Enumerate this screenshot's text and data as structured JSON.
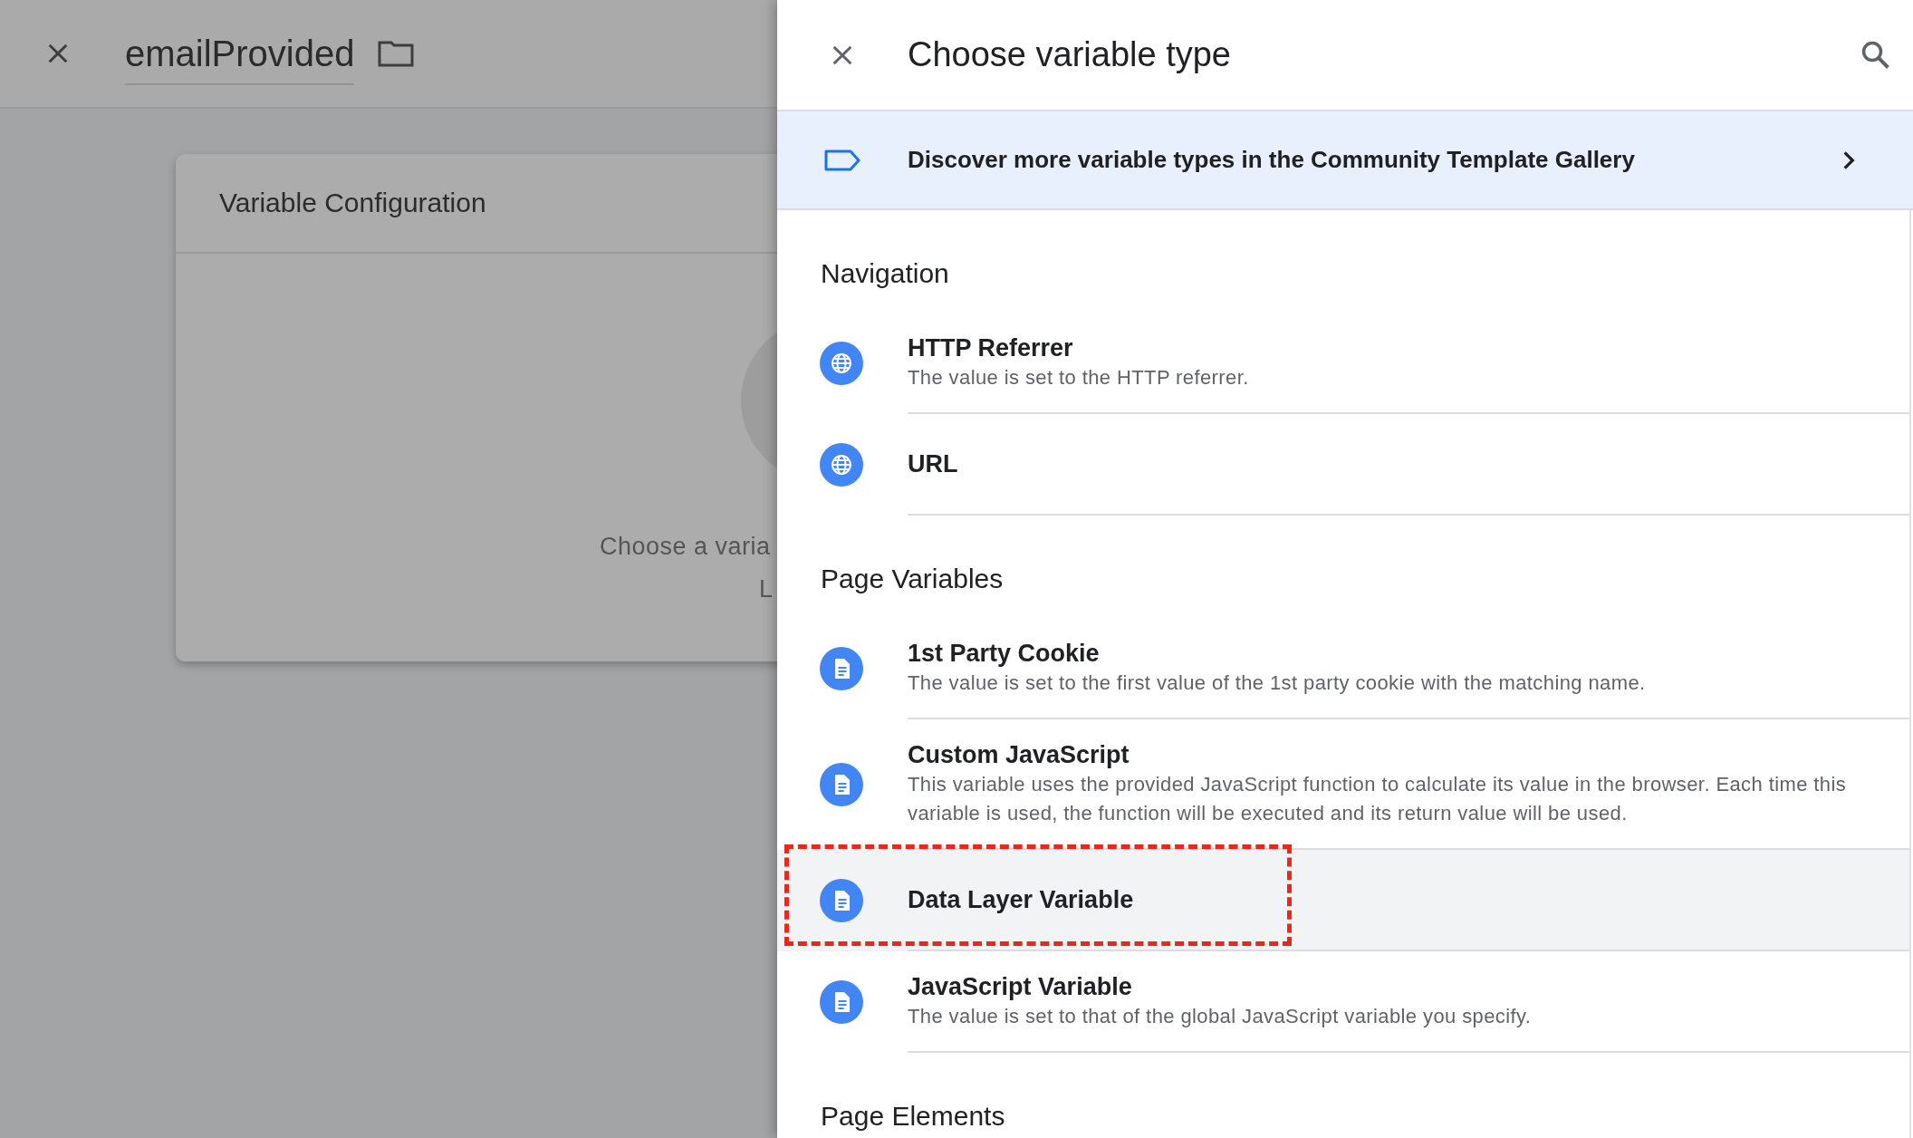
{
  "editor": {
    "name": "emailProvided"
  },
  "config_card": {
    "title": "Variable Configuration",
    "hint_lines": [
      "Choose a varia",
      "L"
    ]
  },
  "picker": {
    "title": "Choose variable type",
    "banner": "Discover more variable types in the Community Template Gallery",
    "sections": [
      {
        "heading": "Navigation",
        "items": [
          {
            "kind": "globe",
            "title": "HTTP Referrer",
            "description": "The value is set to the HTTP referrer.",
            "selected": false,
            "annotated": false
          },
          {
            "kind": "globe",
            "title": "URL",
            "selected": false,
            "annotated": false
          }
        ]
      },
      {
        "heading": "Page Variables",
        "items": [
          {
            "kind": "document",
            "title": "1st Party Cookie",
            "description": "The value is set to the first value of the 1st party cookie with the matching name.",
            "selected": false,
            "annotated": false
          },
          {
            "kind": "document",
            "title": "Custom JavaScript",
            "description": "This variable uses the provided JavaScript function to calculate its value in the browser. Each time this variable is used, the function will be executed and its return value will be used.",
            "selected": false,
            "annotated": false
          },
          {
            "kind": "document",
            "title": "Data Layer Variable",
            "selected": true,
            "annotated": true
          },
          {
            "kind": "document",
            "title": "JavaScript Variable",
            "description": "The value is set to that of the global JavaScript variable you specify.",
            "selected": false,
            "annotated": false
          }
        ]
      },
      {
        "heading": "Page Elements"
      }
    ]
  }
}
